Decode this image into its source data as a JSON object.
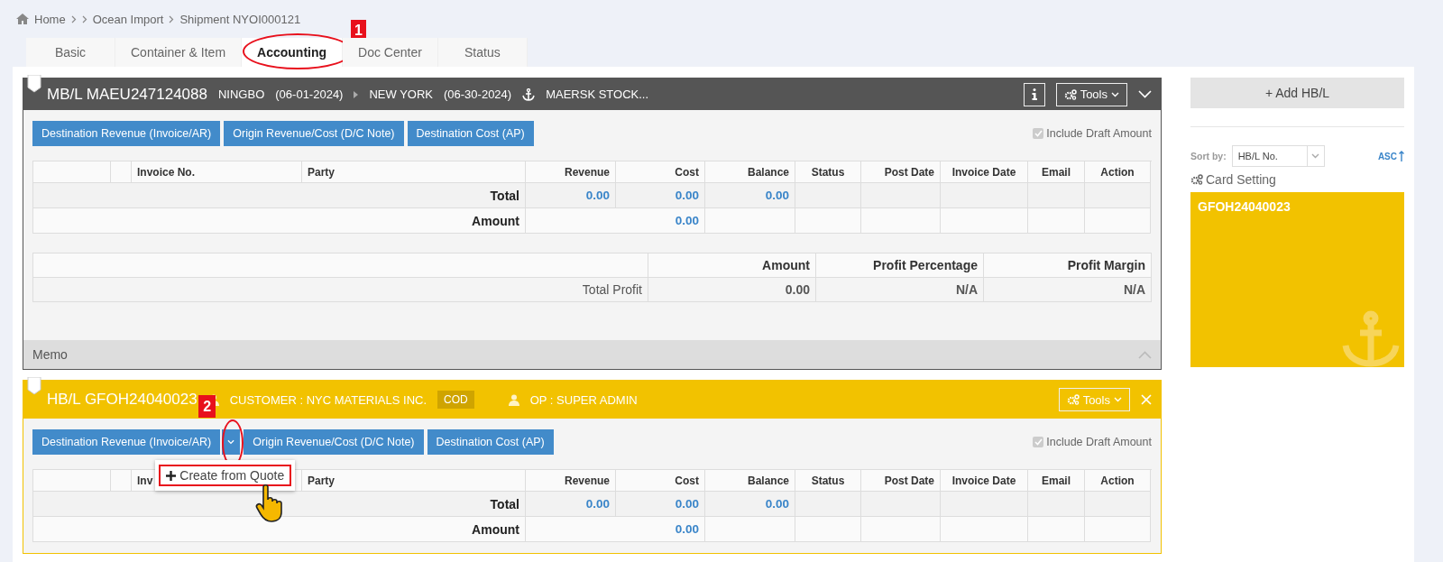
{
  "breadcrumb": [
    {
      "label": "Home",
      "kind": "home"
    },
    {
      "label": "Ocean Import",
      "kind": "after_gap"
    },
    {
      "label": "Shipment NYOI000121",
      "kind": "plain"
    }
  ],
  "tabs": [
    {
      "label": "Basic",
      "selected": false
    },
    {
      "label": "Container & Item",
      "selected": false
    },
    {
      "label": "Accounting",
      "selected": true,
      "callout": "1"
    },
    {
      "label": "Doc Center",
      "selected": false
    },
    {
      "label": "Status",
      "selected": false
    }
  ],
  "sections": [
    {
      "kind": "mbl",
      "title": "MB/L MAEU247124088",
      "origin": "NINGBO",
      "origin_date": "(06-01-2024)",
      "destination": "NEW YORK",
      "destination_date": "(06-30-2024)",
      "vessel": "MAERSK STOCK...",
      "tools": "Tools",
      "buttons": [
        {
          "label": "Destination Revenue (Invoice/AR)"
        },
        {
          "label": "Origin Revenue/Cost (D/C Note)"
        },
        {
          "label": "Destination Cost (AP)"
        }
      ],
      "include_draft": {
        "label": "Include Draft Amount",
        "checked": true
      },
      "table": {
        "columns": [
          "Invoice No.",
          "Party",
          "Revenue",
          "Cost",
          "Balance",
          "Status",
          "Post Date",
          "Invoice Date",
          "Email",
          "Action"
        ],
        "total": {
          "label": "Total",
          "revenue": "0.00",
          "cost": "0.00",
          "balance": "0.00"
        },
        "amount": {
          "label": "Amount",
          "value": "0.00"
        }
      },
      "profit": {
        "columns": [
          "Amount",
          "Profit Percentage",
          "Profit Margin"
        ],
        "label": "Total Profit",
        "values": [
          "0.00",
          "N/A",
          "N/A"
        ]
      },
      "memo": {
        "label": "Memo",
        "expanded": false
      }
    },
    {
      "kind": "hbl",
      "title": "HB/L GFOH24040023",
      "customer": "CUSTOMER : NYC MATERIALS INC.",
      "badge": "COD",
      "op": "OP : SUPER ADMIN",
      "tools": "Tools",
      "buttons": [
        {
          "label": "Destination Revenue (Invoice/AR)",
          "split": true,
          "callout": "2",
          "menu": [
            {
              "label": "Create from Quote",
              "highlighted": true,
              "pointer": true
            }
          ]
        },
        {
          "label": "Origin Revenue/Cost (D/C Note)"
        },
        {
          "label": "Destination Cost (AP)"
        }
      ],
      "include_draft": {
        "label": "Include Draft Amount",
        "checked": true
      },
      "table": {
        "columns": [
          "Inv",
          "Party",
          "Revenue",
          "Cost",
          "Balance",
          "Status",
          "Post Date",
          "Invoice Date",
          "Email",
          "Action"
        ],
        "total": {
          "label": "Total",
          "revenue": "0.00",
          "cost": "0.00",
          "balance": "0.00"
        },
        "amount": {
          "label": "Amount",
          "value": "0.00"
        }
      }
    }
  ],
  "sidebar": {
    "add_button": "+ Add HB/L",
    "sort_label": "Sort by:",
    "sort_value": "HB/L No.",
    "order": "ASC",
    "card_setting": "Card Setting",
    "cards": [
      {
        "title": "GFOH24040023",
        "color": "#f2c200"
      }
    ]
  }
}
